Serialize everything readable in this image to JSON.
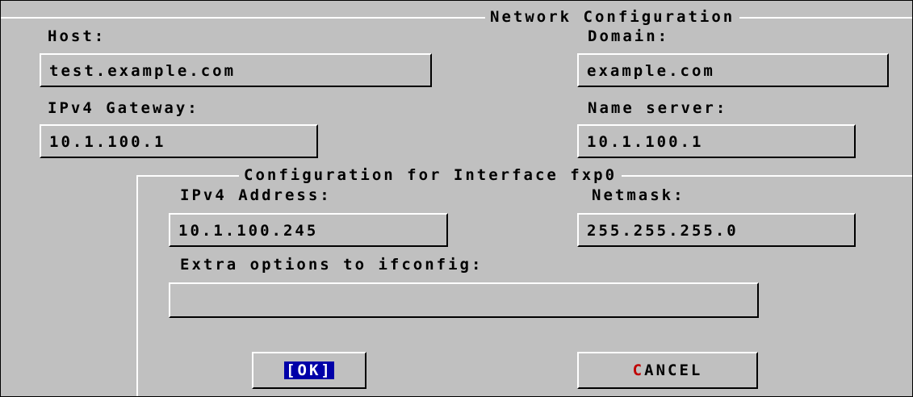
{
  "dialog": {
    "title": "Network Configuration"
  },
  "host": {
    "label": "Host:",
    "value": "test.example.com"
  },
  "domain": {
    "label": "Domain:",
    "value": "example.com"
  },
  "gateway": {
    "label": "IPv4 Gateway:",
    "value": "10.1.100.1"
  },
  "nameserver": {
    "label": "Name server:",
    "value": "10.1.100.1"
  },
  "interface": {
    "title": "Configuration for Interface fxp0",
    "address": {
      "label": "IPv4 Address:",
      "value": "10.1.100.245"
    },
    "netmask": {
      "label": "Netmask:",
      "value": "255.255.255.0"
    },
    "extra": {
      "label": "Extra options to ifconfig:",
      "value": ""
    }
  },
  "buttons": {
    "ok": {
      "label": "[OK]",
      "focused": true
    },
    "cancel": {
      "hotkey": "C",
      "rest": "ANCEL"
    }
  },
  "colors": {
    "background": "#c0c0c0",
    "focus": "#0000a8",
    "hotkey": "#c00000"
  }
}
